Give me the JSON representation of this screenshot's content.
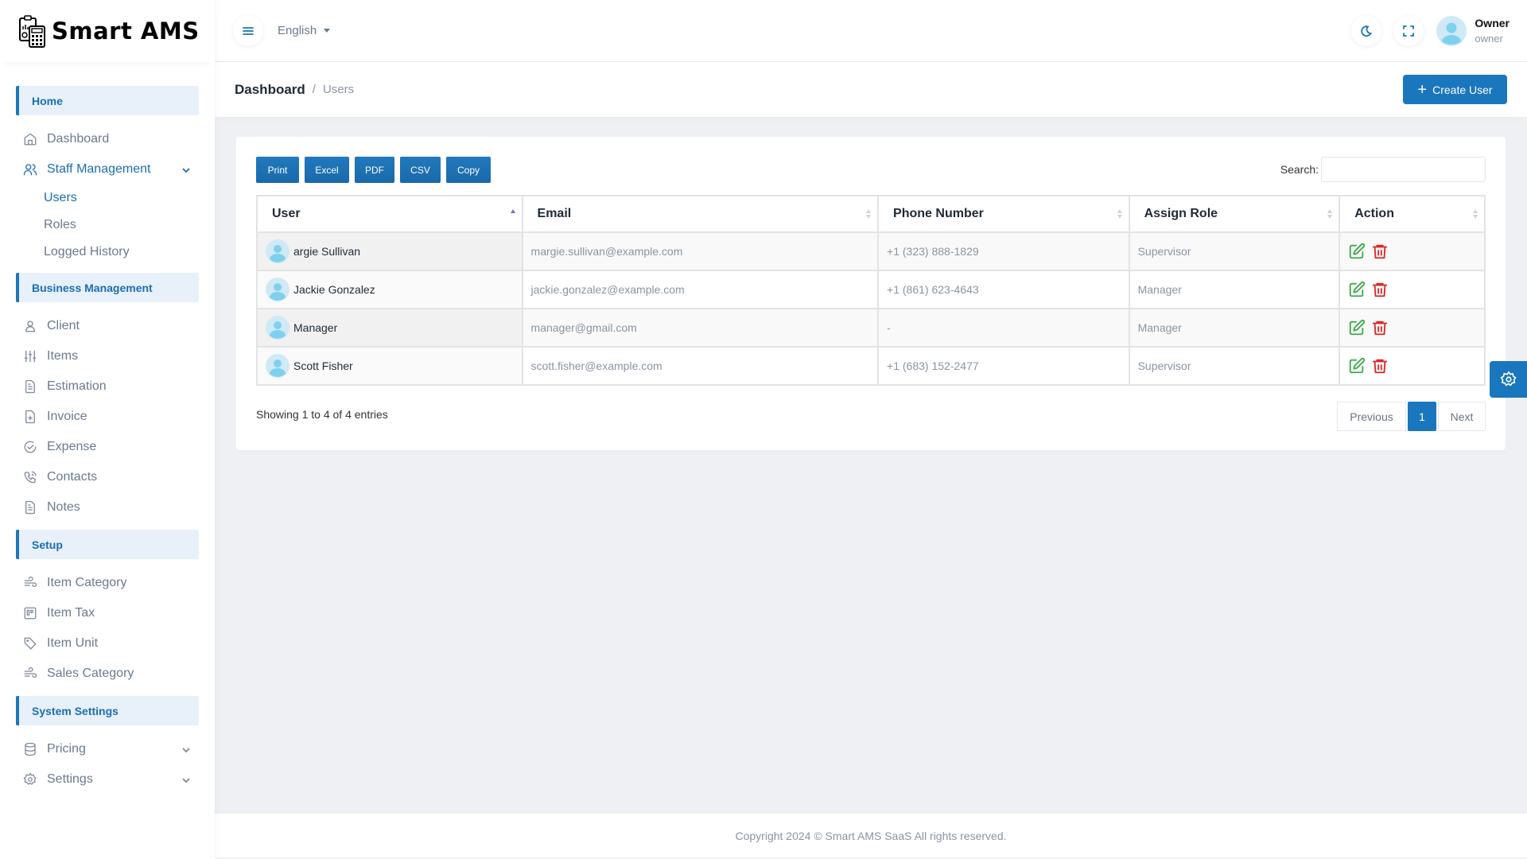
{
  "app": {
    "name": "Smart AMS"
  },
  "header": {
    "language": "English",
    "user_name": "Owner",
    "user_role": "owner"
  },
  "sidebar": {
    "sections": [
      {
        "title": "Home",
        "items": [
          {
            "label": "Dashboard",
            "icon": "home-icon"
          },
          {
            "label": "Staff Management",
            "icon": "users-icon",
            "expanded": true,
            "active": true,
            "children": [
              {
                "label": "Users",
                "active": true
              },
              {
                "label": "Roles"
              },
              {
                "label": "Logged History"
              }
            ]
          }
        ]
      },
      {
        "title": "Business Management",
        "items": [
          {
            "label": "Client",
            "icon": "user-icon"
          },
          {
            "label": "Items",
            "icon": "sliders-icon"
          },
          {
            "label": "Estimation",
            "icon": "document-icon"
          },
          {
            "label": "Invoice",
            "icon": "file-plus-icon"
          },
          {
            "label": "Expense",
            "icon": "check-circle-icon"
          },
          {
            "label": "Contacts",
            "icon": "phone-call-icon"
          },
          {
            "label": "Notes",
            "icon": "document-icon"
          }
        ]
      },
      {
        "title": "Setup",
        "items": [
          {
            "label": "Item Category",
            "icon": "wind-icon"
          },
          {
            "label": "Item Tax",
            "icon": "board-icon"
          },
          {
            "label": "Item Unit",
            "icon": "tag-icon"
          },
          {
            "label": "Sales Category",
            "icon": "wind-icon"
          }
        ]
      },
      {
        "title": "System Settings",
        "items": [
          {
            "label": "Pricing",
            "icon": "database-icon",
            "has_children": true
          },
          {
            "label": "Settings",
            "icon": "gear-icon",
            "has_children": true
          }
        ]
      }
    ]
  },
  "breadcrumb": {
    "parent": "Dashboard",
    "separator": "/",
    "current": "Users"
  },
  "toolbar": {
    "create_label": "Create User",
    "export_buttons": [
      "Print",
      "Excel",
      "PDF",
      "CSV",
      "Copy"
    ],
    "search_label": "Search:",
    "search_value": ""
  },
  "table": {
    "columns": [
      "User",
      "Email",
      "Phone Number",
      "Assign Role",
      "Action"
    ],
    "sorted_column": "User",
    "sort_direction": "asc",
    "rows": [
      {
        "user": "argie Sullivan",
        "email": "margie.sullivan@example.com",
        "phone": "+1 (323) 888-1829",
        "role": "Supervisor"
      },
      {
        "user": "Jackie Gonzalez",
        "email": "jackie.gonzalez@example.com",
        "phone": "+1 (861) 623-4643",
        "role": "Manager"
      },
      {
        "user": "Manager",
        "email": "manager@gmail.com",
        "phone": "-",
        "role": "Manager"
      },
      {
        "user": "Scott Fisher",
        "email": "scott.fisher@example.com",
        "phone": "+1 (683) 152-2477",
        "role": "Supervisor"
      }
    ]
  },
  "pagination": {
    "info": "Showing 1 to 4 of 4 entries",
    "previous": "Previous",
    "current_page": "1",
    "next": "Next"
  },
  "footer": {
    "text": "Copyright 2024 © Smart AMS SaaS All rights reserved."
  },
  "colors": {
    "primary": "#1a76bd",
    "section_bg": "#e8f1fa",
    "edit": "#3aaa4a",
    "delete": "#e02424"
  }
}
